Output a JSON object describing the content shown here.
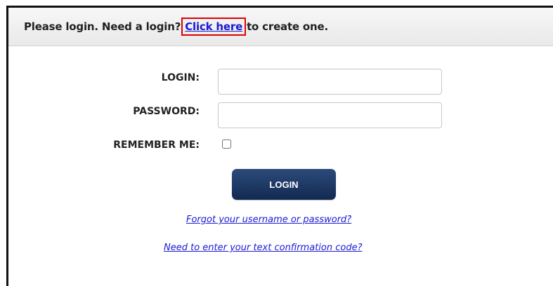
{
  "header": {
    "text_before": "Please login. Need a login?",
    "link_label": "Click here",
    "text_after": "to create one."
  },
  "form": {
    "login_label": "LOGIN:",
    "login_value": "",
    "password_label": "PASSWORD:",
    "password_value": "",
    "remember_label": "REMEMBER ME:",
    "remember_checked": false,
    "submit_label": "LOGIN"
  },
  "links": {
    "forgot": "Forgot your username or password?",
    "code": "Need to enter your text confirmation code?"
  },
  "colors": {
    "link": "#1a1ad4",
    "button": "#1b355f",
    "highlight": "#e00000"
  }
}
